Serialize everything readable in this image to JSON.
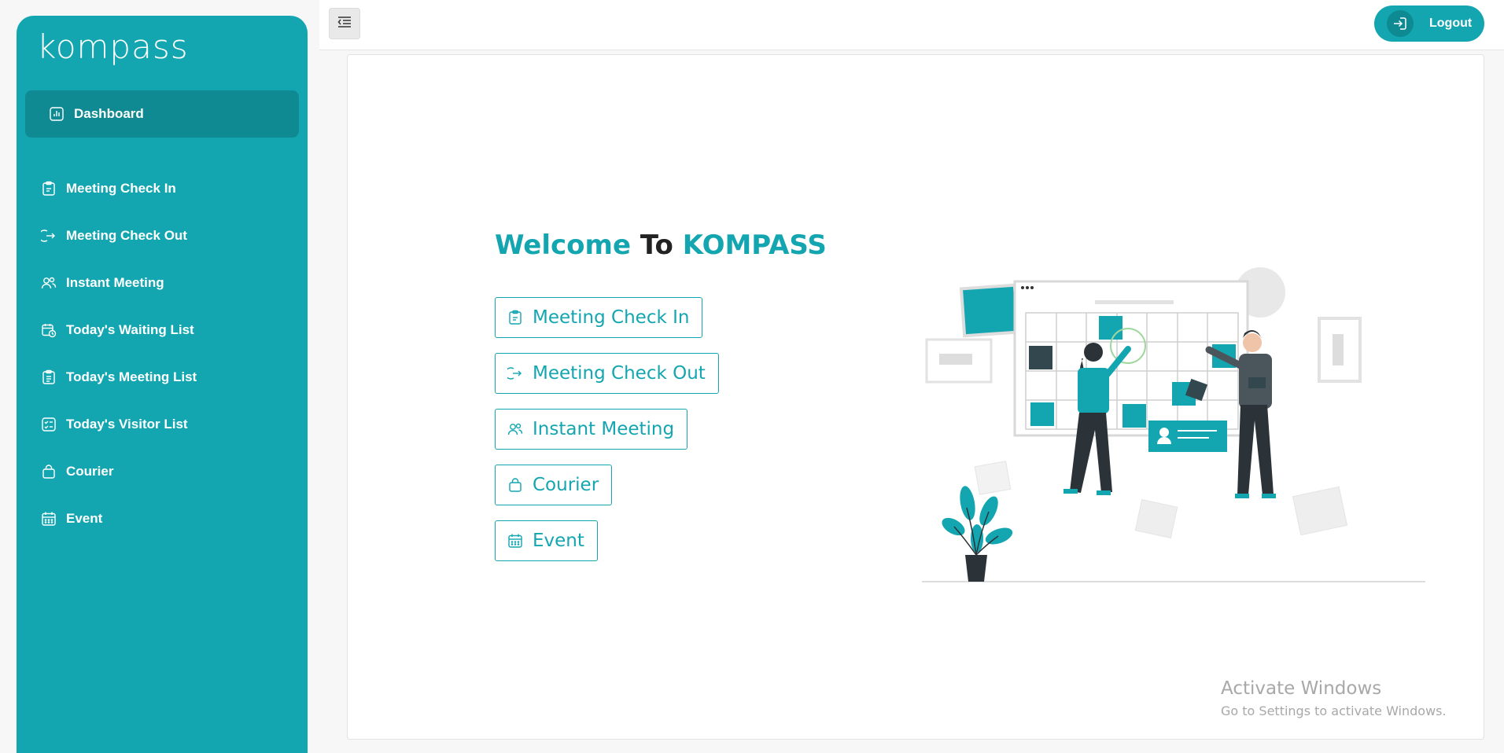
{
  "brand": {
    "logo_text": "kompass"
  },
  "sidebar": {
    "active": {
      "label": "Dashboard",
      "icon": "dashboard-icon"
    },
    "items": [
      {
        "label": "Meeting Check In",
        "icon": "clipboard-icon"
      },
      {
        "label": "Meeting Check Out",
        "icon": "exit-arrow-icon"
      },
      {
        "label": "Instant Meeting",
        "icon": "users-icon"
      },
      {
        "label": "Today's Waiting List",
        "icon": "calendar-clock-icon"
      },
      {
        "label": "Today's Meeting List",
        "icon": "clipboard-list-icon"
      },
      {
        "label": "Today's Visitor List",
        "icon": "checklist-icon"
      },
      {
        "label": "Courier",
        "icon": "bag-icon"
      },
      {
        "label": "Event",
        "icon": "calendar-icon"
      }
    ]
  },
  "topbar": {
    "logout_label": "Logout"
  },
  "main": {
    "welcome_part1": "Welcome",
    "welcome_part2": "To",
    "welcome_part3": "KOMPASS",
    "actions": [
      {
        "label": "Meeting Check In",
        "icon": "clipboard-icon"
      },
      {
        "label": "Meeting Check Out",
        "icon": "exit-arrow-icon"
      },
      {
        "label": "Instant Meeting",
        "icon": "users-icon"
      },
      {
        "label": "Courier",
        "icon": "bag-icon"
      },
      {
        "label": "Event",
        "icon": "calendar-icon"
      }
    ]
  },
  "watermark": {
    "title": "Activate Windows",
    "subtitle": "Go to Settings to activate Windows."
  },
  "colors": {
    "accent": "#14a6b0",
    "accent_dark": "#0f8a92",
    "background": "#f7f7f7"
  }
}
